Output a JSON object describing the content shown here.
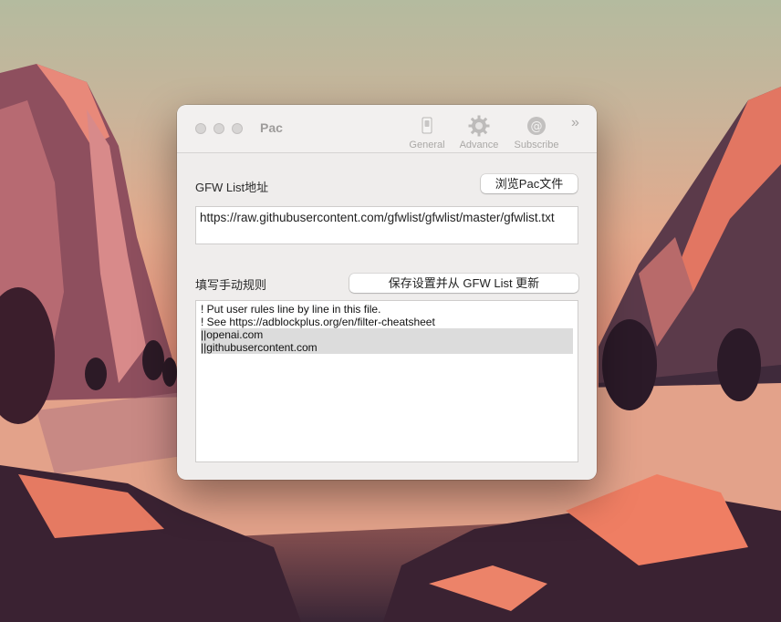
{
  "window": {
    "title": "Pac"
  },
  "toolbar": {
    "items": [
      {
        "label": "General",
        "icon": "switch-icon"
      },
      {
        "label": "Advance",
        "icon": "gear-icon"
      },
      {
        "label": "Subscribe",
        "icon": "at-icon"
      }
    ],
    "more": "»"
  },
  "gfw": {
    "label": "GFW List地址",
    "browse_button": "浏览Pac文件",
    "url": "https://raw.githubusercontent.com/gfwlist/gfwlist/master/gfwlist.txt"
  },
  "rules": {
    "label": "填写手动规则",
    "save_button": "保存设置并从 GFW List 更新",
    "lines": [
      "! Put user rules line by line in this file.",
      "! See https://adblockplus.org/en/filter-cheatsheet",
      "||openai.com",
      "||githubusercontent.com"
    ]
  }
}
